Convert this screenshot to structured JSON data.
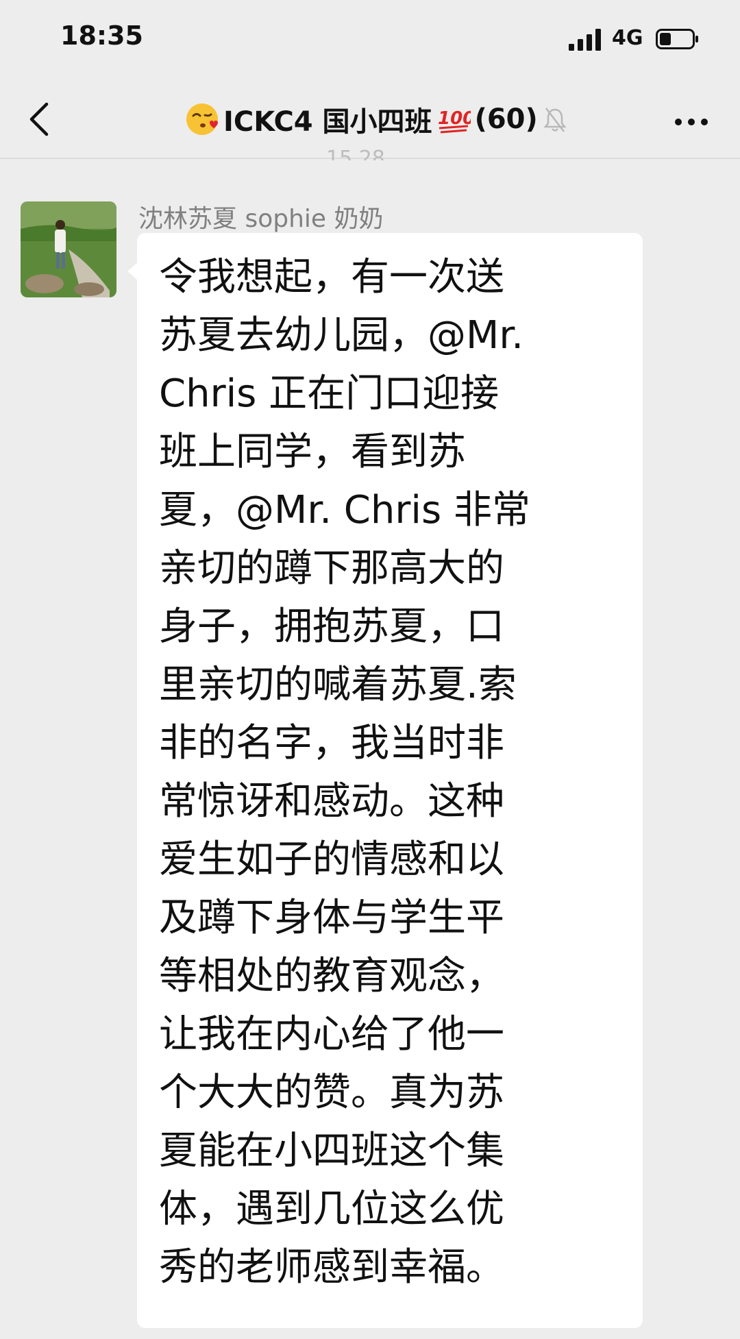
{
  "status_bar": {
    "time": "18:35",
    "network": "4G"
  },
  "header": {
    "title": "ICKC4 国小四班",
    "member_count": "(60)",
    "faded_timestamp": "15 28"
  },
  "message": {
    "sender": "沈林苏夏 sophie 奶奶",
    "lines": [
      "令我想起，有一次送",
      "苏夏去幼儿园，@Mr.",
      "Chris 正在门口迎接",
      "班上同学，看到苏",
      "夏，@Mr. Chris 非常",
      "亲切的蹲下那高大的",
      "身子，拥抱苏夏，口",
      "里亲切的喊着苏夏.索",
      "非的名字，我当时非",
      "常惊讶和感动。这种",
      "爱生如子的情感和以",
      "及蹲下身体与学生平",
      "等相处的教育观念，",
      "让我在内心给了他一",
      "个大大的赞。真为苏",
      "夏能在小四班这个集",
      "体，遇到几位这么优",
      "秀的老师感到幸福。"
    ]
  },
  "icons": {
    "back": "back-arrow-icon",
    "kiss_emoji": "kissing-face-emoji-icon",
    "hundred_emoji": "hundred-points-emoji-icon",
    "mute": "bell-muted-icon",
    "more": "more-dots-icon"
  },
  "colors": {
    "background": "#ededed",
    "bubble": "#ffffff",
    "sender_name": "#808080",
    "hundred_emoji": "#e02424"
  }
}
